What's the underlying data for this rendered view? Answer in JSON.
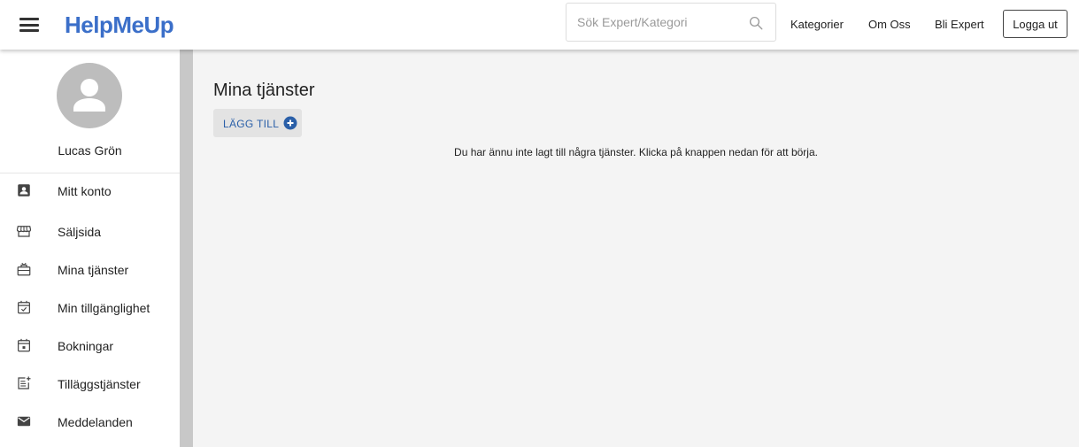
{
  "header": {
    "logo": "HelpMeUp",
    "search_placeholder": "Sök Expert/Kategori",
    "nav": [
      "Kategorier",
      "Om Oss",
      "Bli Expert"
    ],
    "logout_label": "Logga ut"
  },
  "sidebar": {
    "user_name": "Lucas Grön",
    "items": [
      {
        "label": "Mitt konto",
        "icon": "account-box-icon"
      },
      {
        "label": "Säljsida",
        "icon": "storefront-icon"
      },
      {
        "label": "Mina tjänster",
        "icon": "services-icon"
      },
      {
        "label": "Min tillgänglighet",
        "icon": "calendar-check-icon"
      },
      {
        "label": "Bokningar",
        "icon": "calendar-event-icon"
      },
      {
        "label": "Tilläggstjänster",
        "icon": "post-add-icon"
      },
      {
        "label": "Meddelanden",
        "icon": "mail-icon"
      }
    ]
  },
  "main": {
    "title": "Mina tjänster",
    "add_label": "LÄGG TILL",
    "empty_message": "Du har ännu inte lagt till några tjänster. Klicka på knappen nedan för att börja."
  },
  "colors": {
    "brand": "#3b6fc9",
    "button_text": "#2a5fa8"
  }
}
